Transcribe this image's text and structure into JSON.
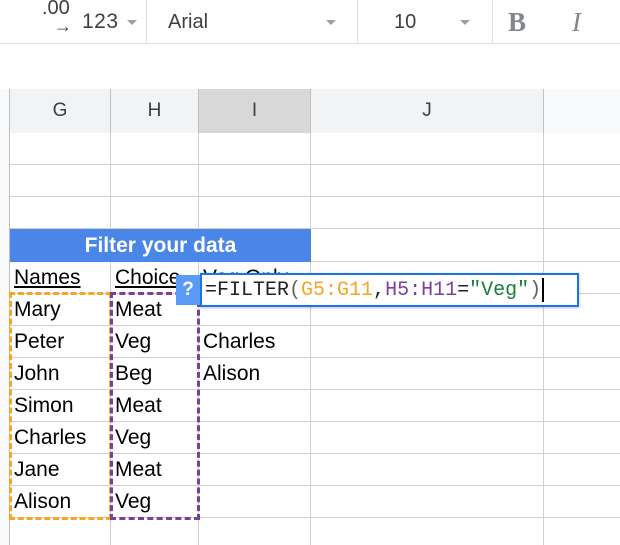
{
  "toolbar": {
    "decimal_icon": "decrease-decimal-icon",
    "decimal_label": ".00",
    "decimal_arrow": "→",
    "number_format_label": "123",
    "font_name": "Arial",
    "font_size": "10",
    "bold_label": "B",
    "italic_label": "I"
  },
  "sheet": {
    "columns": [
      {
        "label": "G",
        "selected": false
      },
      {
        "label": "H",
        "selected": false
      },
      {
        "label": "I",
        "selected": true
      },
      {
        "label": "J",
        "selected": false
      }
    ],
    "banner": {
      "text": "Filter your data",
      "bg_color": "#4a86e8",
      "text_color": "#ffffff"
    },
    "headers": {
      "names": "Names",
      "choice": "Choice",
      "veg_only": "Veg Only"
    },
    "names": [
      "Mary",
      "Peter",
      "John",
      "Simon",
      "Charles",
      "Jane",
      "Alison"
    ],
    "choices": [
      "Meat",
      "Veg",
      "Beg",
      "Meat",
      "Veg",
      "Meat",
      "Veg"
    ],
    "results": [
      "Charles",
      "Alison"
    ],
    "help_badge": "?",
    "formula": {
      "full_text": "=FILTER(G5:G11,H5:H11=\"Veg\")",
      "prefix": "=FILTER",
      "open_paren": "(",
      "range1": "G5:G11",
      "comma": ",",
      "range2": "H5:H11",
      "operator": "=",
      "criterion": "\"Veg\"",
      "close_paren": ")",
      "range1_color": "#f5a623",
      "range2_color": "#7b3fa0",
      "criterion_color": "#188038"
    },
    "selection_ranges": {
      "orange_range": "G5:G11",
      "purple_range": "H5:H11"
    }
  }
}
